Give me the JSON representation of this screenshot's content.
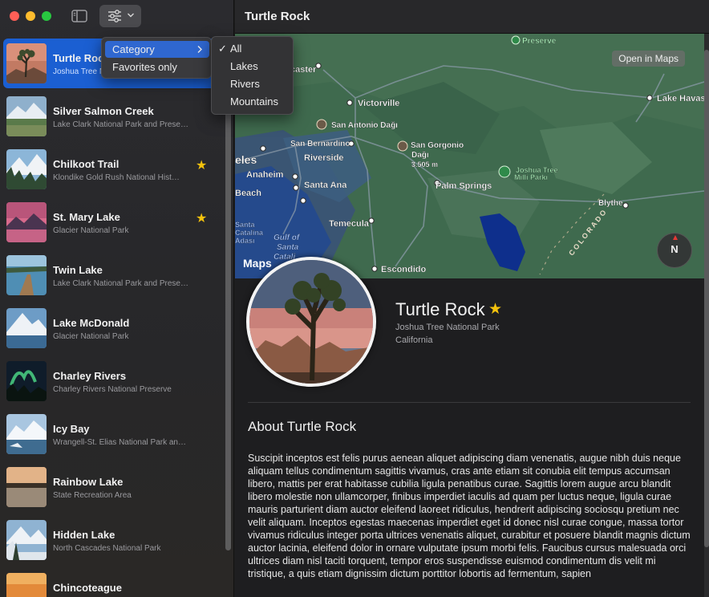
{
  "window": {
    "controls": {
      "close": "#ff5f57",
      "minimize": "#febc2e",
      "zoom": "#28c840"
    },
    "sidebar_toggle_icon": "sidebar-icon",
    "filter_icon": "slider-horizontal-icon"
  },
  "filter_menu": {
    "items": [
      {
        "label": "Category",
        "submenu": true
      },
      {
        "label": "Favorites only",
        "submenu": false
      }
    ],
    "category_submenu": {
      "selected": "All",
      "options": [
        "All",
        "Lakes",
        "Rivers",
        "Mountains"
      ]
    }
  },
  "landmarks": [
    {
      "name": "Turtle Rock",
      "park": "Joshua Tree National Park",
      "favorite": false,
      "selected": true
    },
    {
      "name": "Silver Salmon Creek",
      "park": "Lake Clark National Park and Preserve",
      "favorite": false,
      "selected": false
    },
    {
      "name": "Chilkoot Trail",
      "park": "Klondike Gold Rush National Hist…",
      "favorite": true,
      "selected": false
    },
    {
      "name": "St. Mary Lake",
      "park": "Glacier National Park",
      "favorite": true,
      "selected": false
    },
    {
      "name": "Twin Lake",
      "park": "Lake Clark National Park and Preserve",
      "favorite": false,
      "selected": false
    },
    {
      "name": "Lake McDonald",
      "park": "Glacier National Park",
      "favorite": false,
      "selected": false
    },
    {
      "name": "Charley Rivers",
      "park": "Charley Rivers National Preserve",
      "favorite": false,
      "selected": false
    },
    {
      "name": "Icy Bay",
      "park": "Wrangell-St. Elias National Park and…",
      "favorite": false,
      "selected": false
    },
    {
      "name": "Rainbow Lake",
      "park": "State Recreation Area",
      "favorite": false,
      "selected": false
    },
    {
      "name": "Hidden Lake",
      "park": "North Cascades National Park",
      "favorite": false,
      "selected": false
    },
    {
      "name": "Chincoteague",
      "park": "",
      "favorite": false,
      "selected": false
    }
  ],
  "detail": {
    "window_title": "Turtle Rock",
    "name": "Turtle Rock",
    "favorite": true,
    "park": "Joshua Tree National Park",
    "state": "California",
    "about_title": "About Turtle Rock",
    "about_body": "Suscipit inceptos est felis purus aenean aliquet adipiscing diam venenatis, augue nibh duis neque aliquam tellus condimentum sagittis vivamus, cras ante etiam sit conubia elit tempus accumsan libero, mattis per erat habitasse cubilia ligula penatibus curae. Sagittis lorem augue arcu blandit libero molestie non ullamcorper, finibus imperdiet iaculis ad quam per luctus neque, ligula curae mauris parturient diam auctor eleifend laoreet ridiculus, hendrerit adipiscing sociosqu pretium nec velit aliquam. Inceptos egestas maecenas imperdiet eget id donec nisl curae congue, massa tortor vivamus ridiculus integer porta ultrices venenatis aliquet, curabitur et posuere blandit magnis dictum auctor lacinia, eleifend dolor in ornare vulputate ipsum morbi felis. Faucibus cursus malesuada orci ultrices diam nisl taciti torquent, tempor eros suspendisse euismod condimentum dis velit mi tristique, a quis etiam dignissim dictum porttitor lobortis ad fermentum, sapien"
  },
  "map": {
    "open_button": "Open in Maps",
    "compass_label": "N",
    "attribution": "Maps",
    "labels": {
      "preserve": "Preserve",
      "lancaster": "caster",
      "victorville": "Victorville",
      "lake_havasu": "Lake Havas",
      "san_antonio": "San Antonio Dağı",
      "san_bernardino": "San Bernardino",
      "san_gorgonio": "San Gorgonio",
      "dagi": "Dağı",
      "elevation": "3.505 m",
      "les": "eles",
      "anaheim": "Anaheim",
      "riverside": "Riverside",
      "joshua_tree_park": "Joshua Tree",
      "milli_parki": "Milli Parkı",
      "long_beach": "Beach",
      "santa_ana": "Santa Ana",
      "palm_springs": "Palm Springs",
      "blythe": "Blythe",
      "temecula": "Temecula",
      "santa": "Santa",
      "catalina": "Catalina",
      "adasi": "Adası",
      "gulf": "Gulf of",
      "santa2": "Santa",
      "catalina2": "Catali",
      "escondido": "Escondido",
      "colorado": "C O L O R A D O"
    }
  },
  "colors": {
    "accent": "#1b5fd2",
    "star": "#f4c20d",
    "menu_highlight": "#2f67d0"
  }
}
